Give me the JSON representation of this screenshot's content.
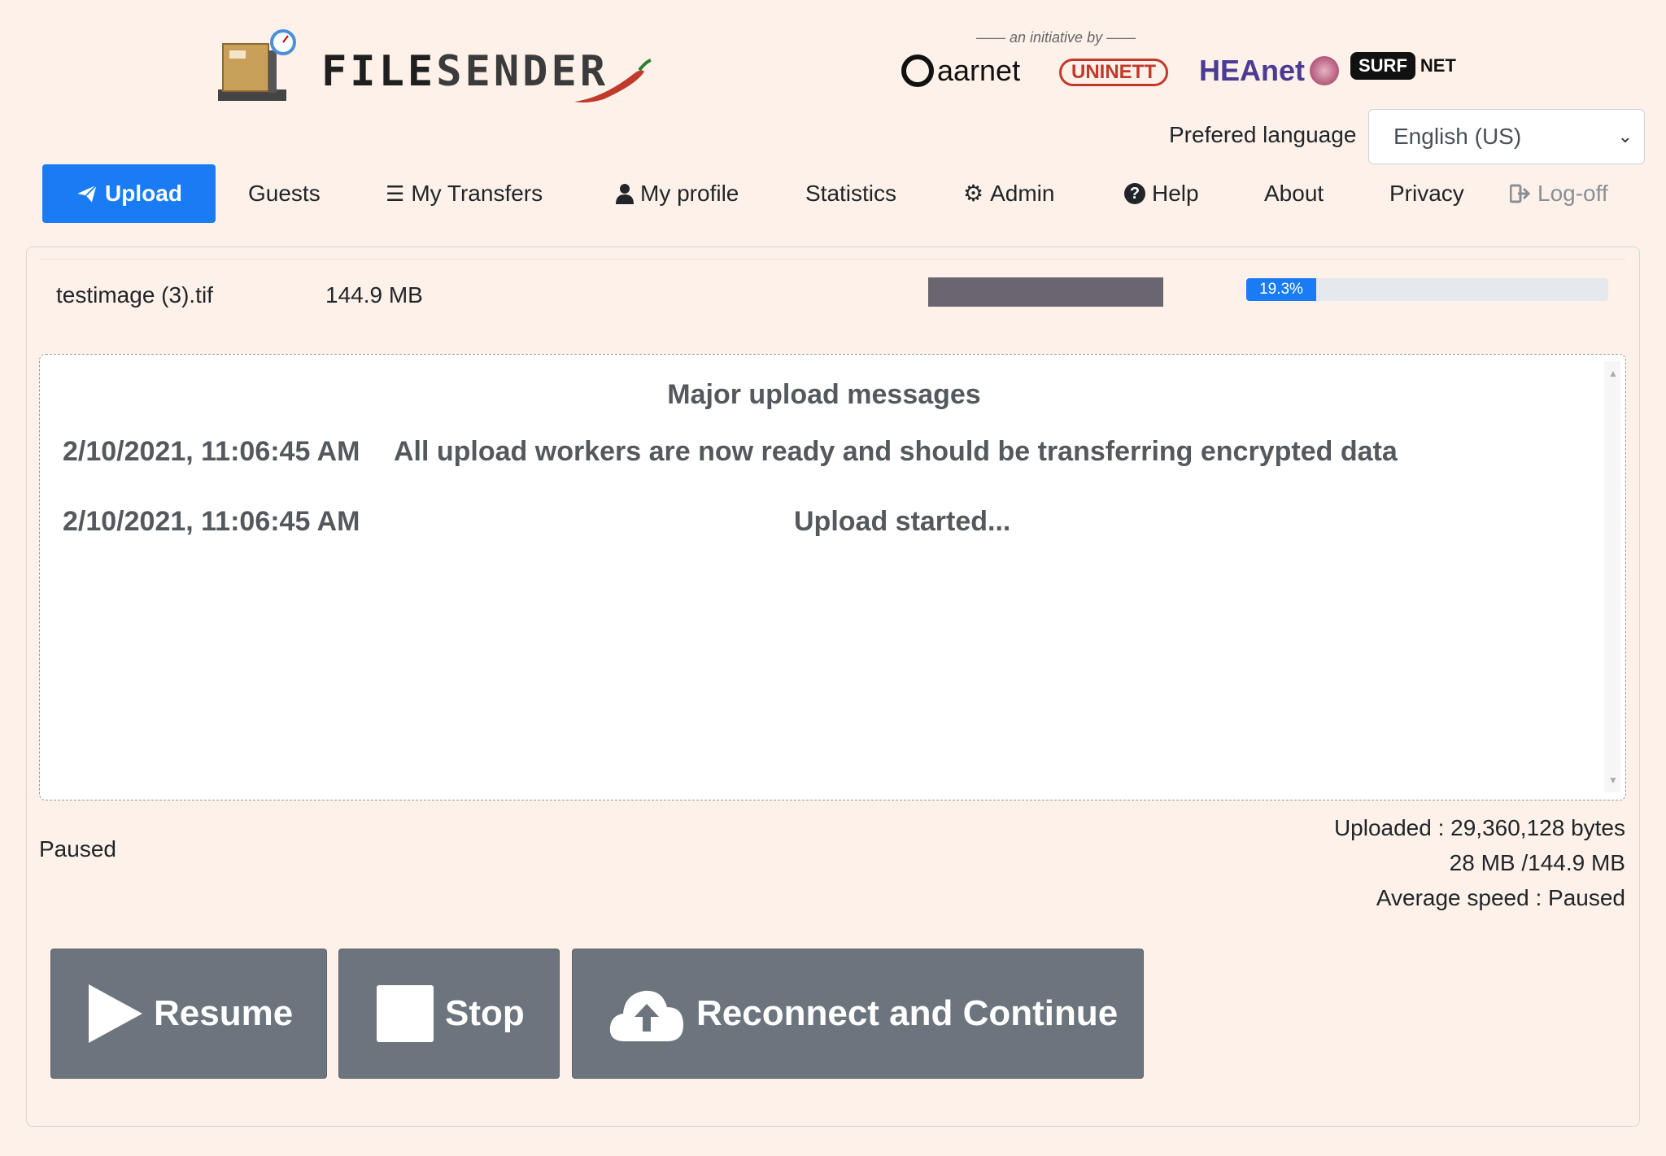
{
  "header": {
    "app_name_part1": "FILE",
    "app_name_part2": "SENDER",
    "initiative_text": "an initiative by",
    "partners": [
      "aarnet",
      "UNINETT",
      "HEAnet",
      "SURF",
      "NET"
    ]
  },
  "language": {
    "label": "Prefered language",
    "selected": "English (US)"
  },
  "nav": {
    "upload": "Upload",
    "guests": "Guests",
    "my_transfers": "My Transfers",
    "my_profile": "My profile",
    "statistics": "Statistics",
    "admin": "Admin",
    "help": "Help",
    "about": "About",
    "privacy": "Privacy",
    "logoff": "Log-off"
  },
  "file": {
    "name": "testimage (3).tif",
    "size": "144.9 MB",
    "progress_label": "19.3%",
    "progress_fraction": 0.193
  },
  "messages": {
    "title": "Major upload messages",
    "rows": [
      {
        "time": "2/10/2021, 11:06:45 AM",
        "text": "All upload workers are now ready and should be transferring encrypted data"
      },
      {
        "time": "2/10/2021, 11:06:45 AM",
        "text": "Upload started..."
      }
    ]
  },
  "status": {
    "state": "Paused",
    "uploaded": "Uploaded : 29,360,128 bytes",
    "amount": "28 MB /144.9 MB",
    "speed": "Average speed : Paused"
  },
  "buttons": {
    "resume": "Resume",
    "stop": "Stop",
    "reconnect": "Reconnect and Continue"
  },
  "colors": {
    "accent": "#1a7cf5",
    "background": "#fdf1e9",
    "button": "#6c757d"
  }
}
